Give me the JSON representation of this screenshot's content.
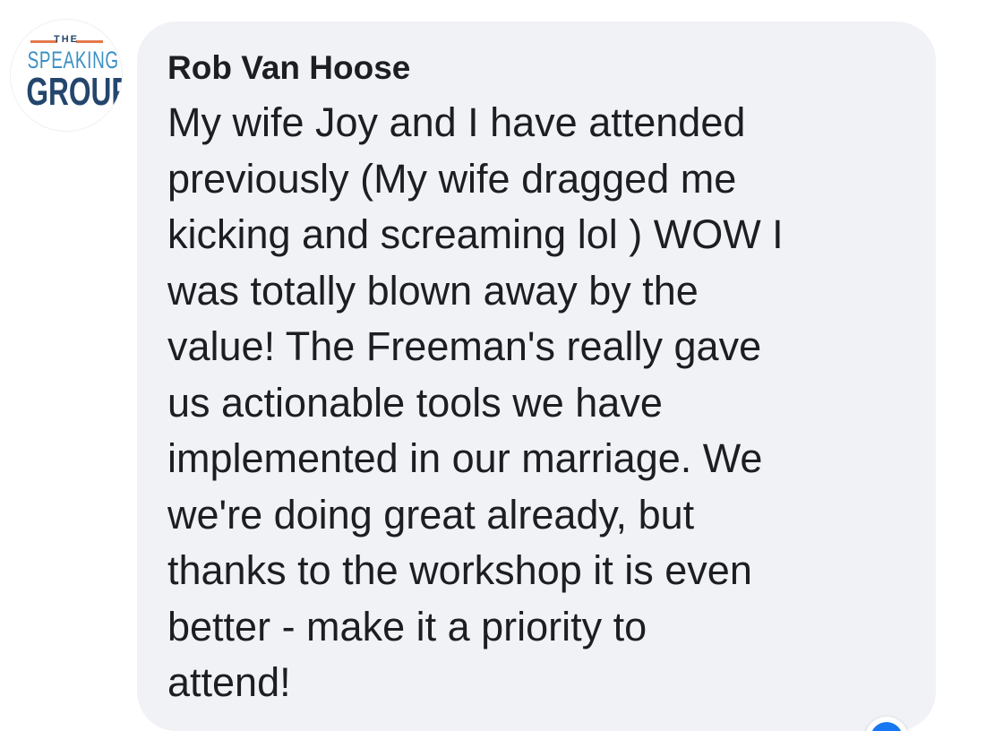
{
  "comment": {
    "author": "Rob Van Hoose",
    "avatar": {
      "logo_top": "THE",
      "logo_middle": "SPEAKING",
      "logo_bottom": "GROUP",
      "colors": {
        "navy": "#24466d",
        "blue": "#3b8fc4",
        "accent": "#e5794b"
      }
    },
    "lines": [
      "My wife Joy and I have attended",
      "previously (My wife dragged me",
      "kicking and screaming lol ) WOW I",
      "was totally blown away by the",
      "value! The Freeman's really gave",
      "us actionable tools we have",
      "implemented in our marriage. We",
      "we're doing great already, but",
      "thanks to the workshop it is even",
      "better - make it a priority to",
      "attend!"
    ],
    "reaction_icon": "like-reaction-icon",
    "colors": {
      "bubble_background": "#f0f2f5",
      "text": "#1c1e21",
      "reaction": "#1877f2"
    }
  }
}
